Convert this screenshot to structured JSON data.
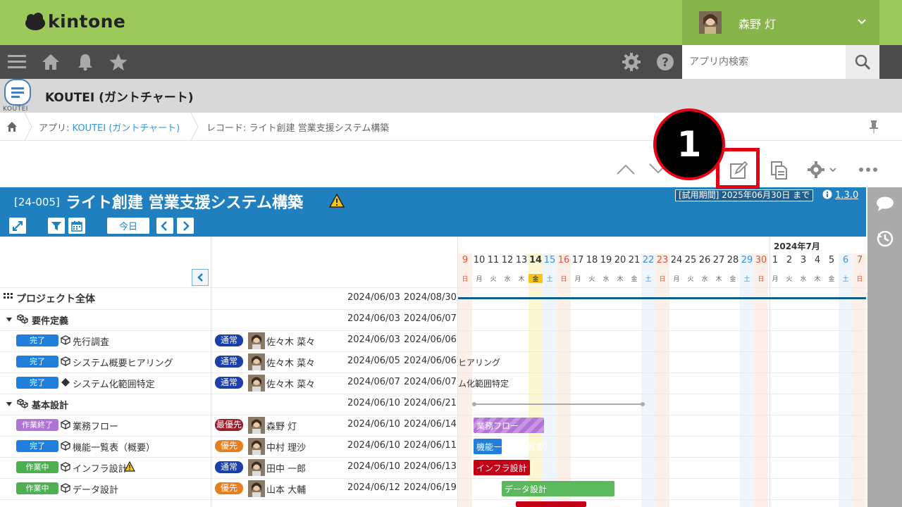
{
  "header": {
    "brand": "kintone",
    "user_name": "森野 灯",
    "search_placeholder": "アプリ内検索"
  },
  "app": {
    "title": "KOUTEI (ガントチャート)",
    "icon_label": "KOUTEI"
  },
  "breadcrumb": {
    "app_prefix": "アプリ: ",
    "app_link": "KOUTEI (ガントチャート)",
    "record": "レコード: ライト創建 営業支援システム構築"
  },
  "annotation": {
    "marker": "1"
  },
  "gantt": {
    "record_id": "[24-005]",
    "record_title": "ライト創建 営業支援システム構築",
    "trial_notice": "[試用期間] 2025年06月30日 まで",
    "version": "1.3.0",
    "today_button": "今日",
    "month_label": "2024年7月",
    "days": [
      {
        "d": "9",
        "w": "日"
      },
      {
        "d": "10",
        "w": "月"
      },
      {
        "d": "11",
        "w": "火"
      },
      {
        "d": "12",
        "w": "水"
      },
      {
        "d": "13",
        "w": "木"
      },
      {
        "d": "14",
        "w": "金"
      },
      {
        "d": "15",
        "w": "土"
      },
      {
        "d": "16",
        "w": "日"
      },
      {
        "d": "17",
        "w": "月"
      },
      {
        "d": "18",
        "w": "火"
      },
      {
        "d": "19",
        "w": "水"
      },
      {
        "d": "20",
        "w": "木"
      },
      {
        "d": "21",
        "w": "金"
      },
      {
        "d": "22",
        "w": "土"
      },
      {
        "d": "23",
        "w": "日"
      },
      {
        "d": "24",
        "w": "月"
      },
      {
        "d": "25",
        "w": "火"
      },
      {
        "d": "26",
        "w": "水"
      },
      {
        "d": "27",
        "w": "木"
      },
      {
        "d": "28",
        "w": "金"
      },
      {
        "d": "29",
        "w": "土"
      },
      {
        "d": "30",
        "w": "日"
      },
      {
        "d": "1",
        "w": "月"
      },
      {
        "d": "2",
        "w": "火"
      },
      {
        "d": "3",
        "w": "水"
      },
      {
        "d": "4",
        "w": "木"
      },
      {
        "d": "5",
        "w": "金"
      },
      {
        "d": "6",
        "w": "土"
      },
      {
        "d": "7",
        "w": "日"
      }
    ],
    "rows": [
      {
        "type": "project",
        "name": "プロジェクト全体",
        "start": "2024/06/03",
        "end": "2024/08/30"
      },
      {
        "type": "group",
        "name": "要件定義",
        "start": "2024/06/03",
        "end": "2024/06/07"
      },
      {
        "type": "task",
        "status": "完了",
        "status_color": "#1f7fdb",
        "name": "先行調査",
        "priority": "通常",
        "priority_color": "#1a3fa8",
        "assignee": "佐々木 菜々",
        "start": "2024/06/03",
        "end": "2024/06/06"
      },
      {
        "type": "task",
        "status": "完了",
        "status_color": "#1f7fdb",
        "name": "システム概要ヒアリング",
        "priority": "通常",
        "priority_color": "#1a3fa8",
        "assignee": "佐々木 菜々",
        "start": "2024/06/05",
        "end": "2024/06/06",
        "bar_label": "ヒアリング"
      },
      {
        "type": "milestone",
        "status": "完了",
        "status_color": "#1f7fdb",
        "name": "システム化範囲特定",
        "priority": "通常",
        "priority_color": "#1a3fa8",
        "assignee": "佐々木 菜々",
        "start": "2024/06/07",
        "end": "2024/06/07",
        "bar_label": "ム化範囲特定"
      },
      {
        "type": "group",
        "name": "基本設計",
        "start": "2024/06/10",
        "end": "2024/06/21"
      },
      {
        "type": "task",
        "status": "作業終了",
        "status_color": "#b073d6",
        "name": "業務フロー",
        "priority": "最優先",
        "priority_color": "#9b1d2a",
        "assignee": "森野 灯",
        "start": "2024/06/10",
        "end": "2024/06/14",
        "bar_label": "業務フロー"
      },
      {
        "type": "task",
        "status": "完了",
        "status_color": "#1f7fdb",
        "name": "機能一覧表（概要）",
        "priority": "優先",
        "priority_color": "#e67e22",
        "assignee": "中村 理沙",
        "start": "2024/06/10",
        "end": "2024/06/11",
        "bar_label": "機能一覧表（概要）"
      },
      {
        "type": "task",
        "status": "作業中",
        "status_color": "#4caf50",
        "name": "インフラ設計",
        "priority": "通常",
        "priority_color": "#1a3fa8",
        "assignee": "田中 一郎",
        "start": "2024/06/10",
        "end": "2024/06/13",
        "bar_label": "インフラ設計",
        "warn": true
      },
      {
        "type": "task",
        "status": "作業中",
        "status_color": "#4caf50",
        "name": "データ設計",
        "priority": "優先",
        "priority_color": "#e67e22",
        "assignee": "山本 大輔",
        "start": "2024/06/12",
        "end": "2024/06/19",
        "bar_label": "データ設計"
      }
    ]
  },
  "colors": {
    "header_green": "#9cc95a",
    "gantt_blue": "#1f7fbf",
    "highlight_red": "#e60012"
  }
}
